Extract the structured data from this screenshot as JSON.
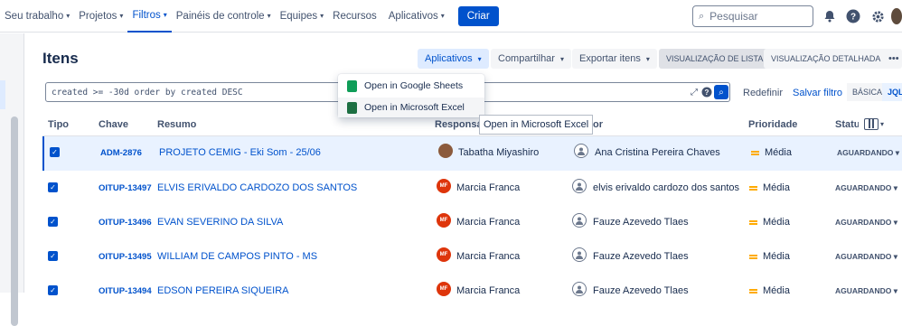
{
  "topnav": {
    "items": [
      {
        "label": "Seu trabalho",
        "chev": "▾"
      },
      {
        "label": "Projetos",
        "chev": "▾"
      },
      {
        "label": "Filtros",
        "chev": "▾"
      },
      {
        "label": "Painéis de controle",
        "chev": "▾"
      },
      {
        "label": "Equipes",
        "chev": "▾"
      },
      {
        "label": "Recursos",
        "chev": ""
      },
      {
        "label": "Aplicativos",
        "chev": "▾"
      }
    ],
    "create_label": "Criar",
    "search_placeholder": "Pesquisar",
    "icons": [
      "bell-icon",
      "help-icon",
      "settings-icon",
      "user-avatar"
    ]
  },
  "page": {
    "title": "Itens",
    "toolbar": {
      "apps": "Aplicativos",
      "share": "Compartilhar",
      "export": "Exportar itens",
      "list_view": "VISUALIZAÇÃO DE LISTA",
      "detail_view": "VISUALIZAÇÃO DETALHADA",
      "more": "•••"
    },
    "jql": "created >= -30d order by created DESC",
    "reset": "Redefinir",
    "save_filter": "Salvar filtro",
    "mode_basic": "BÁSICA",
    "mode_jql": "JQL"
  },
  "dropdown": {
    "items": [
      {
        "label": "Open in Google Sheets",
        "color": "#0f9d58"
      },
      {
        "label": "Open in Microsoft Excel",
        "color": "#1d6f42"
      }
    ],
    "tooltip": "Open in Microsoft Excel"
  },
  "table": {
    "headers": {
      "type": "Tipo",
      "key": "Chave",
      "summary": "Resumo",
      "assignee": "Responsáv",
      "reporter": "or",
      "priority": "Prioridade",
      "status": "Status"
    },
    "rows": [
      {
        "key": "ADM-2876",
        "summary": "PROJETO CEMIG - Eki Som - 25/06",
        "assignee": "Tabatha Miyashiro",
        "assignee_initials": "",
        "assignee_color": "#8b5a3c",
        "reporter": "Ana Cristina Pereira Chaves",
        "priority": "Média",
        "status": "AGUARDANDO"
      },
      {
        "key": "OITUP-13497",
        "summary": "ELVIS ERIVALDO CARDOZO DOS SANTOS",
        "assignee": "Marcia Franca",
        "assignee_initials": "MF",
        "assignee_color": "#de350b",
        "reporter": "elvis erivaldo cardozo dos santos",
        "priority": "Média",
        "status": "AGUARDANDO"
      },
      {
        "key": "OITUP-13496",
        "summary": "EVAN SEVERINO DA SILVA",
        "assignee": "Marcia Franca",
        "assignee_initials": "MF",
        "assignee_color": "#de350b",
        "reporter": "Fauze Azevedo Tlaes",
        "priority": "Média",
        "status": "AGUARDANDO"
      },
      {
        "key": "OITUP-13495",
        "summary": "WILLIAM DE CAMPOS PINTO - MS",
        "assignee": "Marcia Franca",
        "assignee_initials": "MF",
        "assignee_color": "#de350b",
        "reporter": "Fauze Azevedo Tlaes",
        "priority": "Média",
        "status": "AGUARDANDO"
      },
      {
        "key": "OITUP-13494",
        "summary": "EDSON PEREIRA SIQUEIRA",
        "assignee": "Marcia Franca",
        "assignee_initials": "MF",
        "assignee_color": "#de350b",
        "reporter": "Fauze Azevedo Tlaes",
        "priority": "Média",
        "status": "AGUARDANDO"
      }
    ]
  }
}
